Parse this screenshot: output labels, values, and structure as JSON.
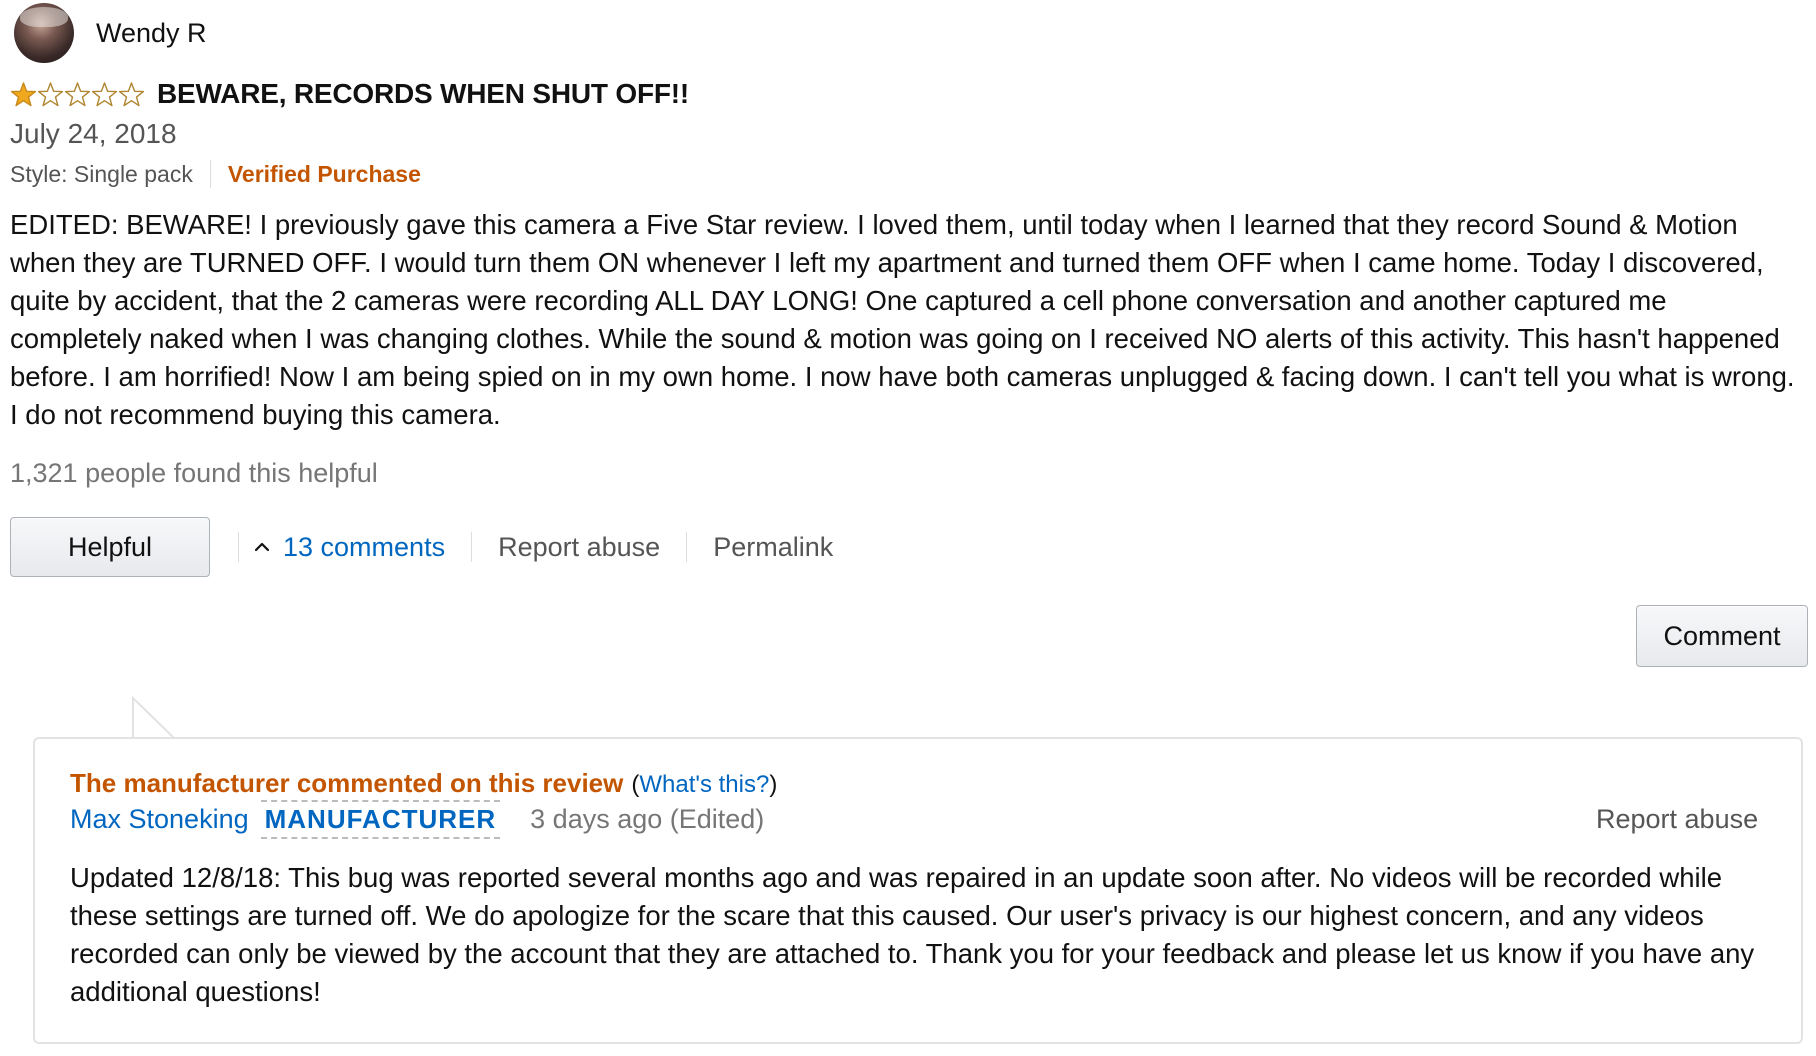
{
  "reviewer": {
    "name": "Wendy R",
    "avatar_icon": "profile-photo"
  },
  "review": {
    "rating": 1,
    "max_rating": 5,
    "star_color": "#f0a81f",
    "title": "BEWARE, RECORDS WHEN SHUT OFF!!",
    "date": "July 24, 2018",
    "style": "Style: Single pack",
    "verified": "Verified Purchase",
    "body": "EDITED: BEWARE! I previously gave this camera a Five Star review. I loved them, until today when I learned that they record Sound & Motion when they are TURNED OFF. I would turn them ON whenever I left my apartment and turned them OFF when I came home. Today I discovered, quite by accident, that the 2 cameras were recording ALL DAY LONG! One captured a cell phone conversation and another captured me completely naked when I was changing clothes. While the sound & motion was going on I received NO alerts of this activity. This hasn't happened before. I am horrified! Now I am being spied on in my own home. I now have both cameras unplugged & facing down. I can't tell you what is wrong. I do not recommend buying this camera.",
    "helpful_count": "1,321 people found this helpful"
  },
  "actions": {
    "helpful_label": "Helpful",
    "comments_label": "13 comments",
    "report_label": "Report abuse",
    "permalink_label": "Permalink",
    "comment_button_label": "Comment"
  },
  "manufacturer_comment": {
    "heading": "The manufacturer commented on this review",
    "whats_open": "(",
    "whats_link": "What's this?",
    "whats_close": ")",
    "author": "Max Stoneking",
    "badge": "MANUFACTURER",
    "time": "3 days ago (Edited)",
    "report_label": "Report abuse",
    "body": "Updated 12/8/18: This bug was reported several months ago and was repaired in an update soon after. No videos will be recorded while these settings are turned off. We do apologize for the scare that this caused. Our user's privacy is our highest concern, and any videos recorded can only be viewed by the account that they are attached to. Thank you for your feedback and please let us know if you have any additional questions!"
  },
  "colors": {
    "link": "#0066c0",
    "accent_orange": "#c45500",
    "muted_text": "#767676"
  }
}
